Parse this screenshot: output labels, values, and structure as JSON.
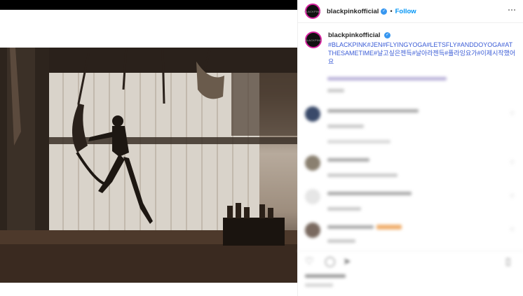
{
  "post": {
    "username": "blackpinkofficial",
    "follow_label": "Follow",
    "separator": "•",
    "more_icon": "⋯",
    "avatar_text": "BLACKPINK",
    "caption_text": "#BLACKPINK#JEN#FLYINGYOGA#LETSFLY#ANDDOYOGA#ATTHESAMETIME#날고싶은젠득#날아라젠득#플라잉요가#이제시작했어요"
  },
  "icons": {
    "verified": "verified-badge-icon",
    "more": "more-options-icon",
    "like": "heart-icon",
    "comment": "comment-icon",
    "share": "share-icon",
    "save": "bookmark-icon"
  },
  "colors": {
    "accent": "#0095f6",
    "hashtag": "#3b5cd6",
    "verified": "#3897f0"
  }
}
